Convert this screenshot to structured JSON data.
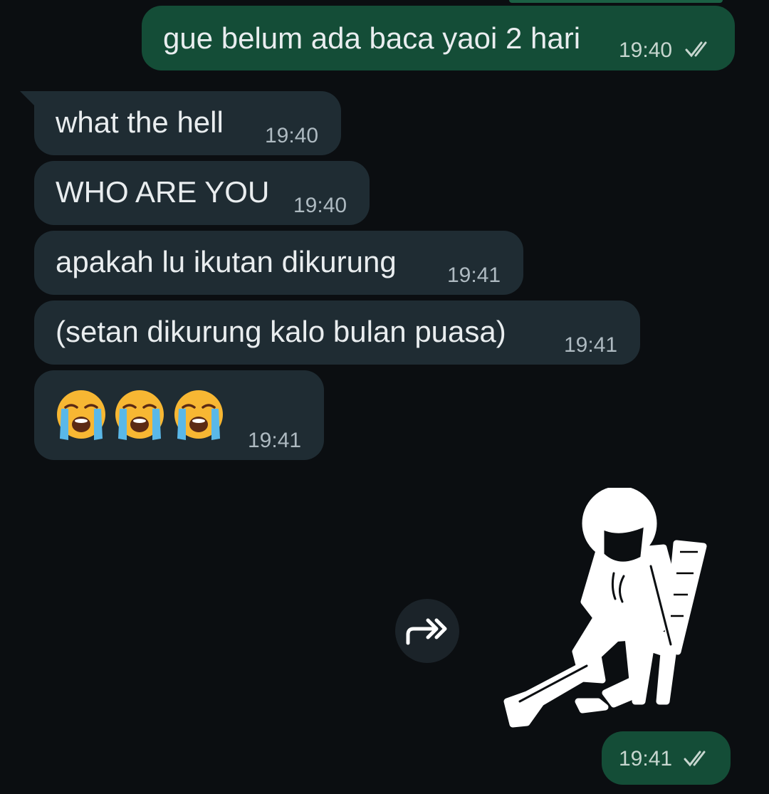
{
  "messages": [
    {
      "direction": "out",
      "text": "gue belum ada baca yaoi 2 hari",
      "time": "19:40",
      "ticks": "read"
    },
    {
      "direction": "in",
      "text": "what the hell",
      "time": "19:40"
    },
    {
      "direction": "in",
      "text": "WHO ARE YOU",
      "time": "19:40"
    },
    {
      "direction": "in",
      "text": "apakah lu ikutan dikurung",
      "time": "19:41"
    },
    {
      "direction": "in",
      "text": "(setan dikurung kalo bulan puasa)",
      "time": "19:41"
    },
    {
      "direction": "in",
      "emoji": [
        "loudly-crying-face",
        "loudly-crying-face",
        "loudly-crying-face"
      ],
      "time": "19:41"
    },
    {
      "direction": "out",
      "type": "sticker",
      "sticker": "sad-stickman-on-chair-with-rifle",
      "time": "19:41",
      "ticks": "read"
    }
  ],
  "forward_icon": "forward-icon",
  "colors": {
    "background": "#0b0e11",
    "outgoing_bubble": "#144d37",
    "incoming_bubble": "#1f2c33",
    "text": "#e9edef",
    "timestamp": "#aebac1"
  }
}
